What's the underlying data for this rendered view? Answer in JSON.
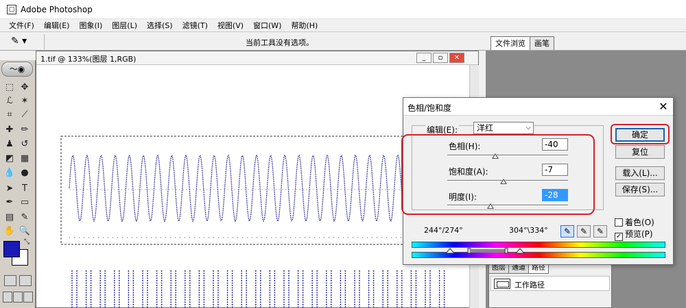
{
  "app": {
    "title": "Adobe Photoshop",
    "icon": "photoshop-app-icon"
  },
  "menu": [
    {
      "label": "文件(F)"
    },
    {
      "label": "编辑(E)"
    },
    {
      "label": "图象(I)"
    },
    {
      "label": "图层(L)"
    },
    {
      "label": "选择(S)"
    },
    {
      "label": "滤镜(T)"
    },
    {
      "label": "视图(V)"
    },
    {
      "label": "窗口(W)"
    },
    {
      "label": "帮助(H)"
    }
  ],
  "options_bar": {
    "tool_icon": "eyedropper-icon",
    "message": "当前工具没有选项。"
  },
  "palette_tabs": [
    "文件浏览",
    "画笔"
  ],
  "document": {
    "title": "1.tif @ 133%(图层 1,RGB)",
    "buttons": {
      "minimize": "_",
      "maximize": "▫",
      "close": "✕"
    }
  },
  "toolbox": {
    "foreground_color": "#1a1ab4",
    "background_color": "#ffffff"
  },
  "layers_panel": {
    "tabs": [
      "图层",
      "通道",
      "路径"
    ],
    "path_name": "工作路径"
  },
  "dialog": {
    "title": "色相/饱和度",
    "edit_label": "编辑(E):",
    "edit_value": "洋红",
    "hue": {
      "label": "色相(H):",
      "value": "-40",
      "slider_fraction": 0.4
    },
    "saturation": {
      "label": "饱和度(A):",
      "value": "-7",
      "slider_fraction": 0.465
    },
    "lightness": {
      "label": "明度(I):",
      "value": "-28",
      "slider_fraction": 0.36
    },
    "buttons": {
      "ok": "确定",
      "reset": "复位",
      "load": "载入(L)...",
      "save": "保存(S)..."
    },
    "range_left": "244°/274°",
    "range_right": "304°\\334°",
    "colorize": {
      "label": "着色(O)",
      "checked": false
    },
    "preview": {
      "label": "预览(P)",
      "checked": true
    }
  },
  "colors": {
    "highlight": "#d61f2b",
    "waveform": "#1e1e8c",
    "default_button_border": "#1a5fb4"
  }
}
